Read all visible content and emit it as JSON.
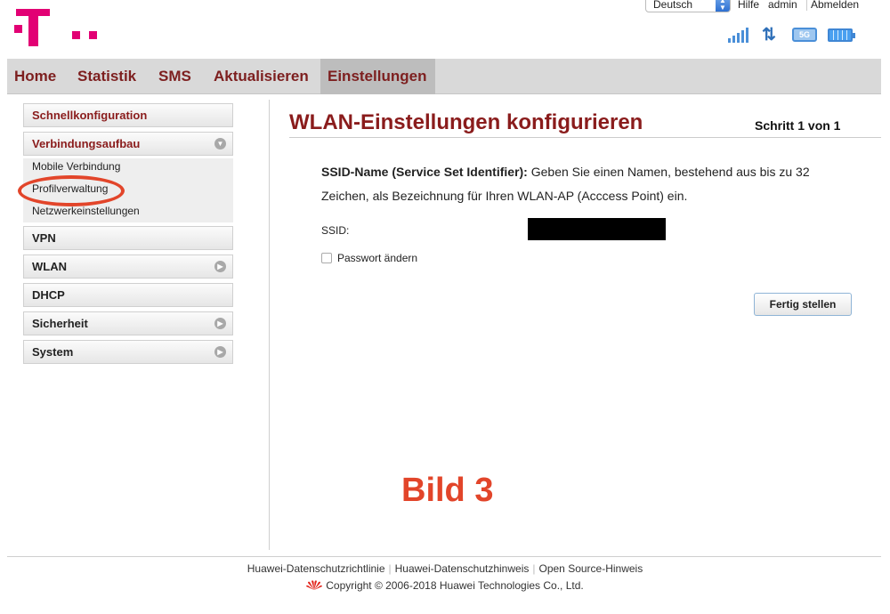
{
  "header": {
    "language": "Deutsch",
    "links": {
      "help": "Hilfe",
      "user": "admin",
      "logout": "Abmelden"
    },
    "status": {
      "network_type": "5G"
    }
  },
  "nav": {
    "items": [
      {
        "label": "Home"
      },
      {
        "label": "Statistik"
      },
      {
        "label": "SMS"
      },
      {
        "label": "Aktualisieren"
      },
      {
        "label": "Einstellungen",
        "active": true
      }
    ]
  },
  "sidebar": {
    "quick_setup": "Schnellkonfiguration",
    "connection": "Verbindungsaufbau",
    "connection_sub": [
      "Mobile Verbindung",
      "Profilverwaltung",
      "Netzwerkeinstellungen"
    ],
    "vpn": "VPN",
    "wlan": "WLAN",
    "dhcp": "DHCP",
    "security": "Sicherheit",
    "system": "System"
  },
  "main": {
    "title": "WLAN-Einstellungen konfigurieren",
    "step": "Schritt 1 von 1",
    "desc_bold": "SSID-Name (Service Set Identifier):",
    "desc_text": "  Geben Sie einen Namen, bestehend aus bis zu 32 Zeichen, als Bezeichnung für Ihren WLAN-AP (Acccess Point) ein.",
    "ssid_label": "SSID:",
    "password_label": "Passwort ändern",
    "finish_label": "Fertig stellen"
  },
  "annotation": "Bild 3",
  "footer": {
    "links": [
      "Huawei-Datenschutzrichtlinie",
      "Huawei-Datenschutzhinweis",
      "Open Source-Hinweis"
    ],
    "copyright": "Copyright © 2006-2018 Huawei Technologies Co., Ltd."
  },
  "colors": {
    "brand_magenta": "#e20074",
    "accent_red": "#8a1c1c",
    "annotation_red": "#e2452a"
  }
}
